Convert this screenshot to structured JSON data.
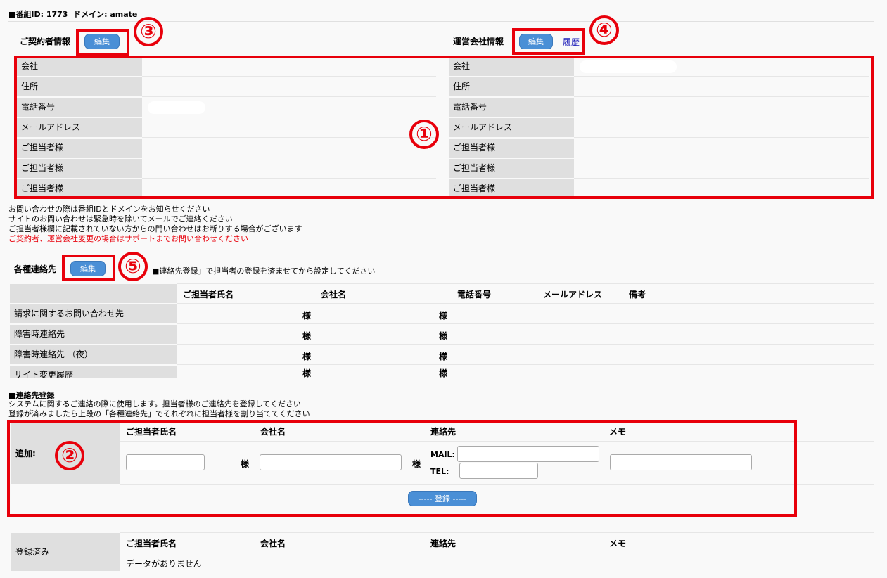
{
  "page": {
    "title_prefix": "■番組ID: 1773",
    "title_domain": "ドメイン: amate"
  },
  "contractor": {
    "heading": "ご契約者情報",
    "edit_label": "編集",
    "rows": [
      "会社",
      "住所",
      "電話番号",
      "メールアドレス",
      "ご担当者様",
      "ご担当者様",
      "ご担当者様"
    ]
  },
  "operator": {
    "heading": "運営会社情報",
    "edit_label": "編集",
    "history_label": "履歴",
    "rows": [
      "会社",
      "住所",
      "電話番号",
      "メールアドレス",
      "ご担当者様",
      "ご担当者様",
      "ご担当者様"
    ]
  },
  "notes": {
    "line1": "お問い合わせの際は番組IDとドメインをお知らせください",
    "line2": "サイトのお問い合わせは緊急時を除いてメールでご連絡ください",
    "line3": "ご担当者様欄に記載されていない方からの問い合わせはお断りする場合がございます",
    "line4_red": "ご契約者、運営会社変更の場合はサポートまでお問い合わせください"
  },
  "contacts": {
    "heading": "各種連絡先",
    "edit_label": "編集",
    "hint": "■連絡先登録」で担当者の登録を済ませてから設定してください",
    "columns": [
      "ご担当者氏名",
      "会社名",
      "電話番号",
      "メールアドレス",
      "備考"
    ],
    "rows": [
      "請求に関するお問い合わせ先",
      "障害時連絡先",
      "障害時連絡先 （夜）",
      "サイト変更履歴"
    ],
    "sama": "様"
  },
  "registration": {
    "heading": "■連絡先登録",
    "desc1": "システムに関するご連絡の際に使用します。担当者様のご連絡先を登録してください",
    "desc2": "登録が済みましたら上段の「各種連絡先」でそれぞれに担当者様を割り当ててください",
    "add_label": "追加:",
    "columns": [
      "ご担当者氏名",
      "会社名",
      "連絡先",
      "メモ"
    ],
    "sama": "様",
    "mail_label": "MAIL:",
    "tel_label": "TEL:",
    "submit_label": "----- 登録 -----"
  },
  "registered": {
    "label": "登録済み",
    "columns": [
      "ご担当者氏名",
      "会社名",
      "連絡先",
      "メモ"
    ],
    "empty": "データがありません"
  },
  "annotations": [
    "①",
    "②",
    "③",
    "④",
    "⑤"
  ],
  "colors": {
    "annotation_red": "#e8000b",
    "button_blue": "#4a8fd6",
    "label_gray": "#dfdfdf",
    "link_blue": "#1a1ab8"
  }
}
